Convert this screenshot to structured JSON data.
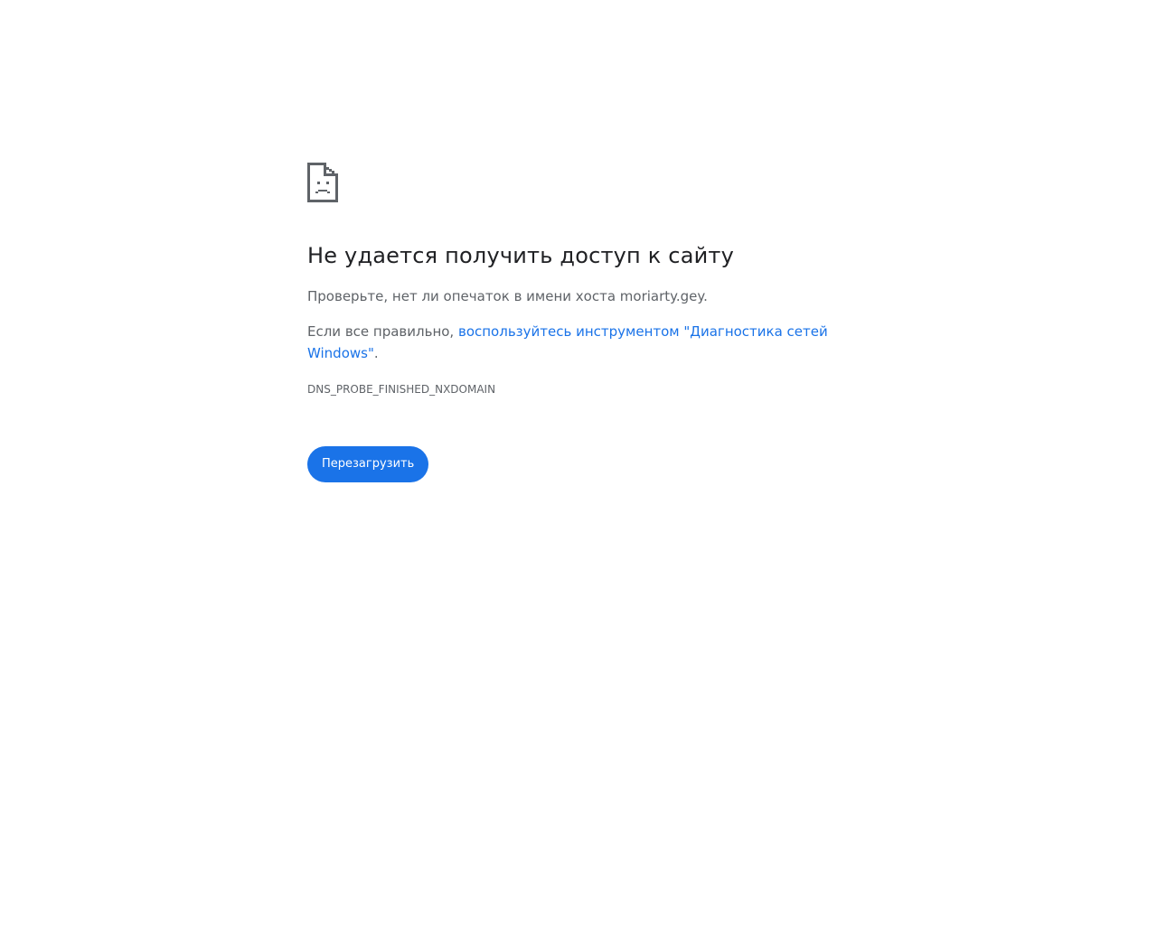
{
  "error": {
    "icon": "sad-page-icon",
    "title": "Не удается получить доступ к сайту",
    "check_text": "Проверьте, нет ли опечаток в имени хоста moriarty.gey.",
    "suggestion_prefix": "Если все правильно, ",
    "suggestion_link": "воспользуйтесь инструментом \"Диагностика сетей Windows\"",
    "suggestion_suffix": ".",
    "code": "DNS_PROBE_FINISHED_NXDOMAIN"
  },
  "actions": {
    "reload_label": "Перезагрузить"
  },
  "colors": {
    "accent": "#1a73e8",
    "text_primary": "#202124",
    "text_secondary": "#5f6368",
    "background": "#ffffff"
  }
}
